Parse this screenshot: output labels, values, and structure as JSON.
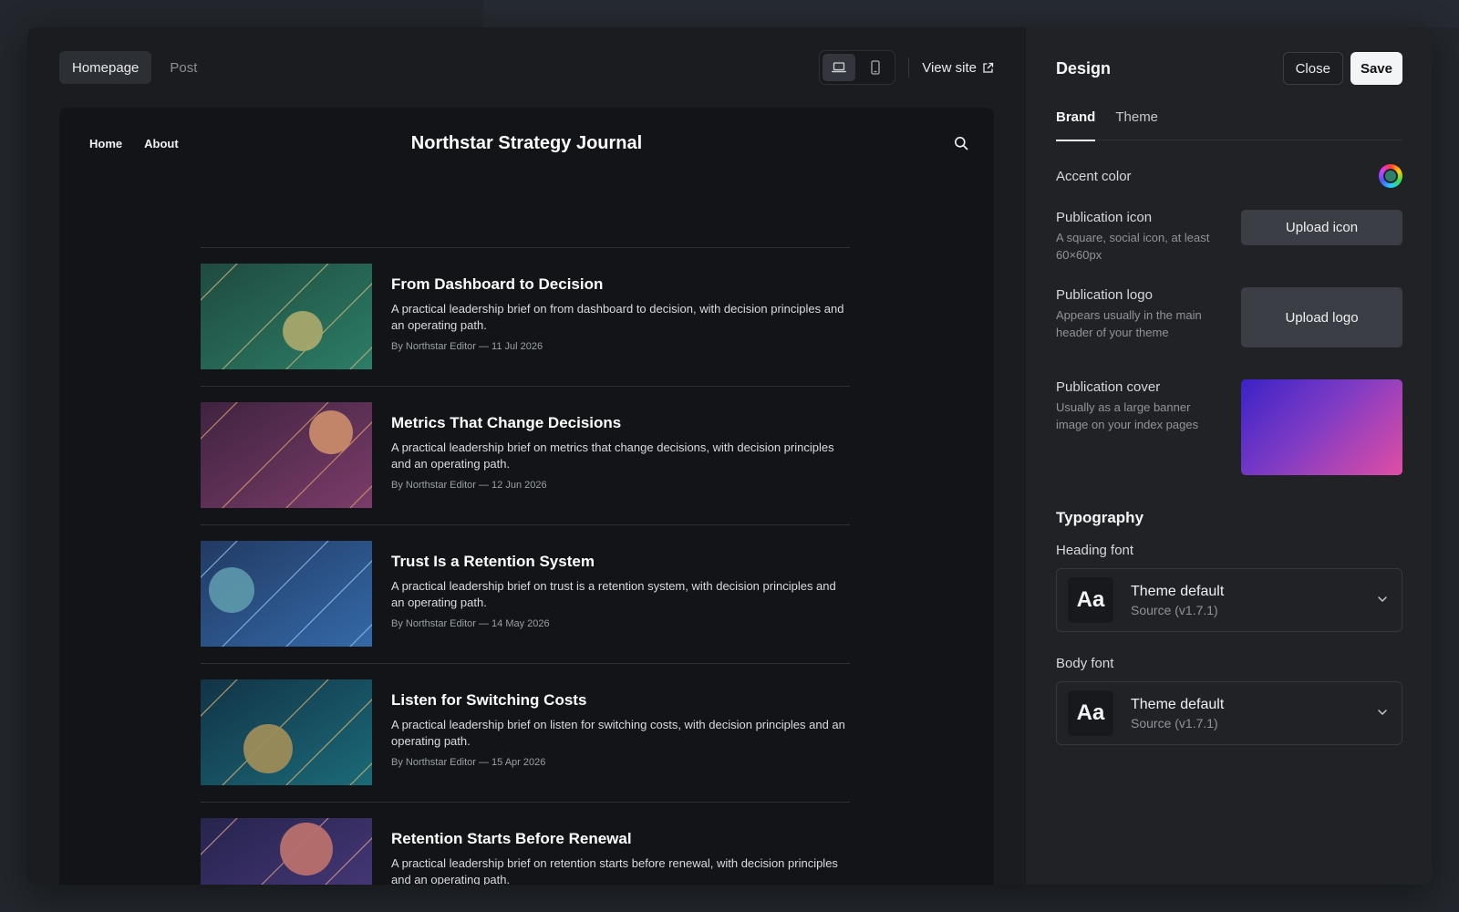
{
  "preview": {
    "tabs": [
      {
        "label": "Homepage",
        "active": true
      },
      {
        "label": "Post",
        "active": false
      }
    ],
    "device_icons": [
      "laptop-icon",
      "mobile-icon"
    ],
    "view_site_label": "View site"
  },
  "site": {
    "nav": [
      "Home",
      "About"
    ],
    "title": "Northstar Strategy Journal",
    "posts": [
      {
        "title": "From Dashboard to Decision",
        "excerpt": "A practical leadership brief on from dashboard to decision, with decision principles and an operating path.",
        "meta": "By Northstar Editor — 11 Jul 2026",
        "colors": [
          "#1f4a3f",
          "#2c7d67"
        ],
        "line_color": "#c8b27a",
        "circle_color": "#a6a86b"
      },
      {
        "title": "Metrics That Change Decisions",
        "excerpt": "A practical leadership brief on metrics that change decisions, with decision principles and an operating path.",
        "meta": "By Northstar Editor — 12 Jun 2026",
        "colors": [
          "#3f2340",
          "#7b3c6a"
        ],
        "line_color": "#d89a6a",
        "circle_color": "#c88a6c"
      },
      {
        "title": "Trust Is a Retention System",
        "excerpt": "A practical leadership brief on trust is a retention system, with decision principles and an operating path.",
        "meta": "By Northstar Editor — 14 May 2026",
        "colors": [
          "#223a63",
          "#3469a8"
        ],
        "line_color": "#8fc0e8",
        "circle_color": "#5b96aa"
      },
      {
        "title": "Listen for Switching Costs",
        "excerpt": "A practical leadership brief on listen for switching costs, with decision principles and an operating path.",
        "meta": "By Northstar Editor — 15 Apr 2026",
        "colors": [
          "#123347",
          "#1b6a78"
        ],
        "line_color": "#d2b071",
        "circle_color": "#9c8c5a"
      },
      {
        "title": "Retention Starts Before Renewal",
        "excerpt": "A practical leadership brief on retention starts before renewal, with decision principles and an operating path.",
        "meta": "",
        "colors": [
          "#26244e",
          "#4b3a7d"
        ],
        "line_color": "#d89a8a",
        "circle_color": "#b8706c"
      }
    ]
  },
  "panel": {
    "title": "Design",
    "close_label": "Close",
    "save_label": "Save",
    "tabs": [
      "Brand",
      "Theme"
    ],
    "accent_label": "Accent color",
    "accent_color": "#2f7f6d",
    "icon": {
      "label": "Publication icon",
      "hint": "A square, social icon, at least 60×60px",
      "button": "Upload icon"
    },
    "logo": {
      "label": "Publication logo",
      "hint": "Appears usually in the main header of your theme",
      "button": "Upload logo"
    },
    "cover": {
      "label": "Publication cover",
      "hint": "Usually as a large banner image on your index pages"
    },
    "typography": {
      "title": "Typography",
      "heading": {
        "label": "Heading font",
        "sample": "Aa",
        "name": "Theme default",
        "version": "Source (v1.7.1)"
      },
      "body": {
        "label": "Body font",
        "sample": "Aa",
        "name": "Theme default",
        "version": "Source (v1.7.1)"
      }
    }
  }
}
